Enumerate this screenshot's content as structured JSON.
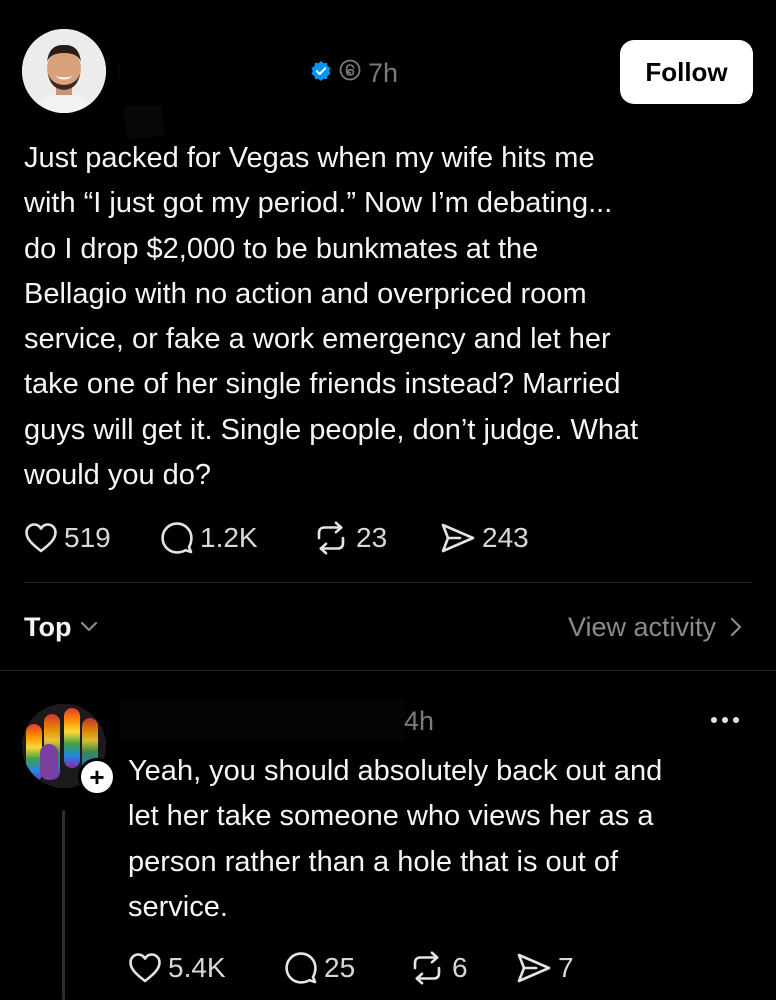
{
  "post": {
    "timestamp": "7h",
    "follow_label": "Follow",
    "text_lines": [
      "Just packed for Vegas when my wife hits me",
      "with “I just got my period.” Now I’m debating...",
      "do I drop $2,000 to be bunkmates at the",
      "Bellagio with no action and overpriced room",
      "service, or fake a work emergency and let her",
      "take one of her single friends instead? Married",
      "guys will get it. Single people, don’t judge. What",
      "would you do?"
    ],
    "stats": {
      "likes": "519",
      "comments": "1.2K",
      "reposts": "23",
      "shares": "243"
    }
  },
  "sort": {
    "label": "Top",
    "view_activity": "View activity"
  },
  "reply": {
    "timestamp": "4h",
    "text_lines": [
      "Yeah, you should absolutely back out and",
      "let her take someone who views her as a",
      "person rather than a hole that is out of",
      "service."
    ],
    "stats": {
      "likes": "5.4K",
      "comments": "25",
      "reposts": "6",
      "shares": "7"
    }
  },
  "colors": {
    "background": "#000000",
    "text": "#f3f5f7",
    "muted": "#7b7b7b",
    "verified": "#0095f6",
    "follow_bg": "#ffffff"
  },
  "icons": [
    "heart-icon",
    "comment-icon",
    "repost-icon",
    "share-icon",
    "verified-icon",
    "threads-icon",
    "chevron-down-icon",
    "chevron-right-icon",
    "more-icon",
    "plus-icon"
  ]
}
